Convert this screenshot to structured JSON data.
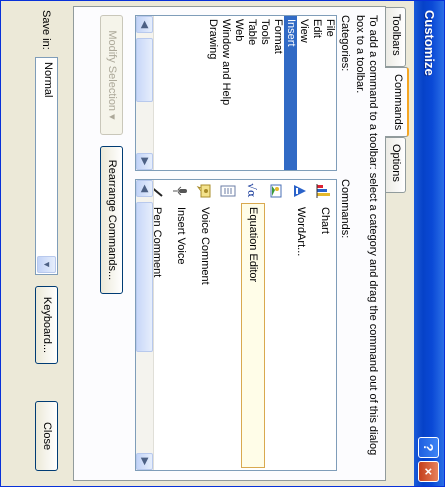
{
  "window": {
    "title": "Customize",
    "help_glyph": "?",
    "close_glyph": "×"
  },
  "tabs": [
    {
      "label": "Toolbars"
    },
    {
      "label": "Commands"
    },
    {
      "label": "Options"
    }
  ],
  "commands_tab": {
    "instructions": "To add a command to a toolbar: select a category and drag the command out of this dialog box to a toolbar.",
    "categories_label": "Categories:",
    "commands_label": "Commands:",
    "categories": [
      "File",
      "Edit",
      "View",
      "Insert",
      "Format",
      "Tools",
      "Table",
      "Web",
      "Window and Help",
      "Drawing"
    ],
    "selected_category": "Insert",
    "commands": [
      {
        "label": "Chart",
        "icon": "chart-icon"
      },
      {
        "label": "WordArt...",
        "icon": "wordart-icon"
      },
      {
        "label": "",
        "icon": "drawing-icon"
      },
      {
        "label": "Equation Editor",
        "icon": "equation-icon"
      },
      {
        "label": "",
        "icon": "document-icon"
      },
      {
        "label": "Voice Comment",
        "icon": "voice-comment-icon"
      },
      {
        "label": "Insert Voice",
        "icon": "insert-voice-icon"
      },
      {
        "label": "Pen Comment",
        "icon": "pen-icon"
      }
    ],
    "selected_command": "Equation Editor",
    "modify_selection_label": "Modify Selection ▾",
    "rearrange_label": "Rearrange Commands..."
  },
  "footer": {
    "save_in_label": "Save in:",
    "save_in_value": "Normal",
    "keyboard_label": "Keyboard...",
    "close_label": "Close"
  },
  "colors": {
    "titlebar": "#0a49d6",
    "selection": "#316ac5",
    "dialog_bg": "#ece9d8",
    "active_tab_accent": "#f5a623"
  }
}
